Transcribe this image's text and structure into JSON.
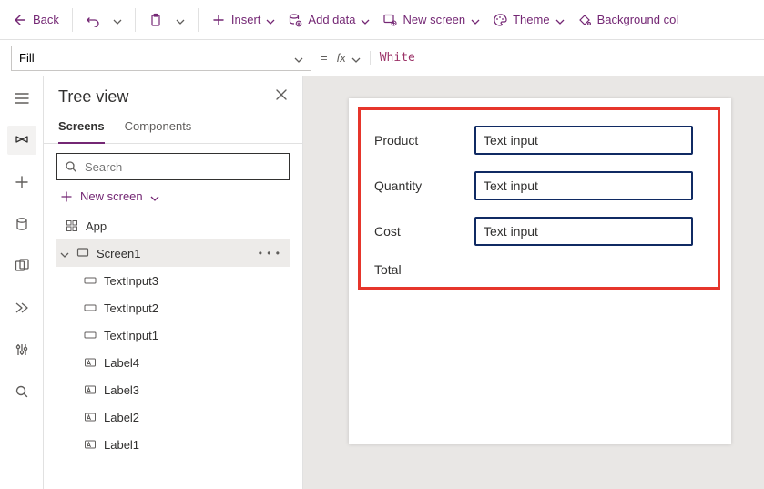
{
  "topbar": {
    "back": "Back",
    "insert": "Insert",
    "add_data": "Add data",
    "new_screen": "New screen",
    "theme": "Theme",
    "bg_color": "Background col"
  },
  "formulabar": {
    "property": "Fill",
    "fx": "fx",
    "value": "White"
  },
  "tree": {
    "title": "Tree view",
    "tabs": {
      "screens": "Screens",
      "components": "Components"
    },
    "search_placeholder": "Search",
    "new_screen": "New screen",
    "app": "App",
    "screen1": "Screen1",
    "children": [
      "TextInput3",
      "TextInput2",
      "TextInput1",
      "Label4",
      "Label3",
      "Label2",
      "Label1"
    ]
  },
  "canvas": {
    "labels": {
      "product": "Product",
      "quantity": "Quantity",
      "cost": "Cost",
      "total": "Total"
    },
    "input_placeholder": "Text input"
  }
}
